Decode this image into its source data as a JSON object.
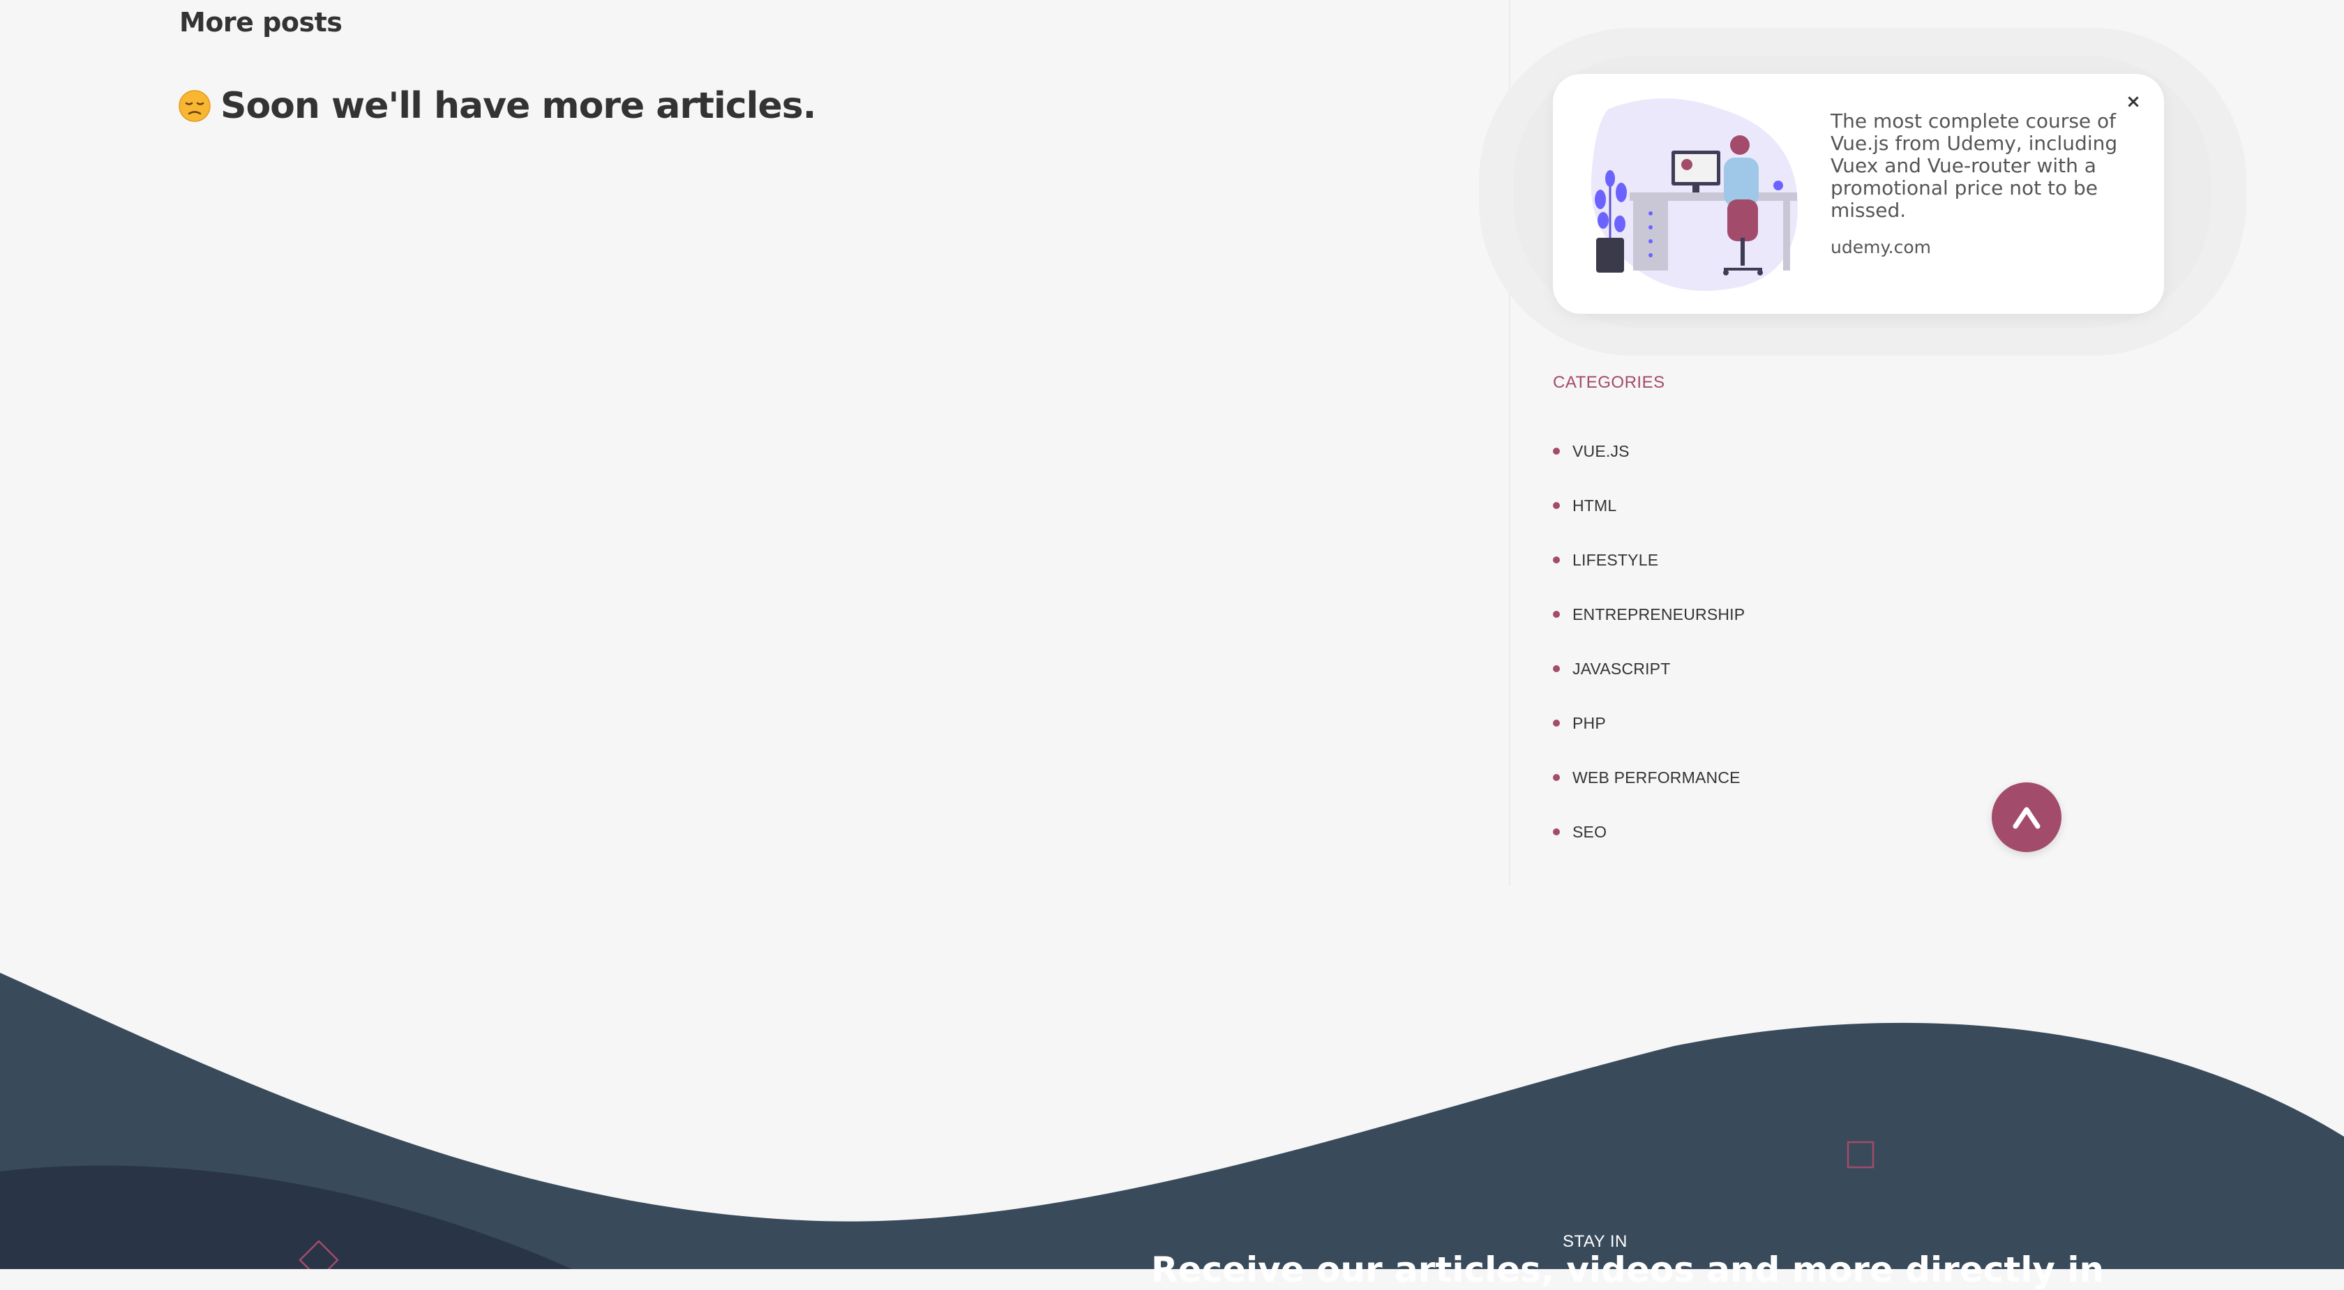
{
  "main": {
    "more_posts_heading": "More posts",
    "empty_message": "Soon we'll have more articles.",
    "empty_icon": "sad-face-icon"
  },
  "ad": {
    "text": "The most complete course of Vue.js from Udemy, including Vuex and Vue-router with a promotional price not to be missed.",
    "domain": "udemy.com",
    "close_label": "×",
    "illustration": "person-at-desk-illustration"
  },
  "categories": {
    "title": "CATEGORIES",
    "items": [
      {
        "label": "VUE.JS"
      },
      {
        "label": "HTML"
      },
      {
        "label": "LIFESTYLE"
      },
      {
        "label": "ENTREPRENEURSHIP"
      },
      {
        "label": "JAVASCRIPT"
      },
      {
        "label": "PHP"
      },
      {
        "label": "WEB PERFORMANCE"
      },
      {
        "label": "SEO"
      }
    ]
  },
  "scroll_top": {
    "icon": "chevron-up-icon"
  },
  "footer": {
    "kicker": "STAY IN",
    "heading": "Receive our articles, videos and more directly in"
  },
  "colors": {
    "accent": "#a34b6a",
    "footer_bg": "#394a5b",
    "footer_dark": "#2a3447",
    "page_bg": "#f6f6f6"
  }
}
